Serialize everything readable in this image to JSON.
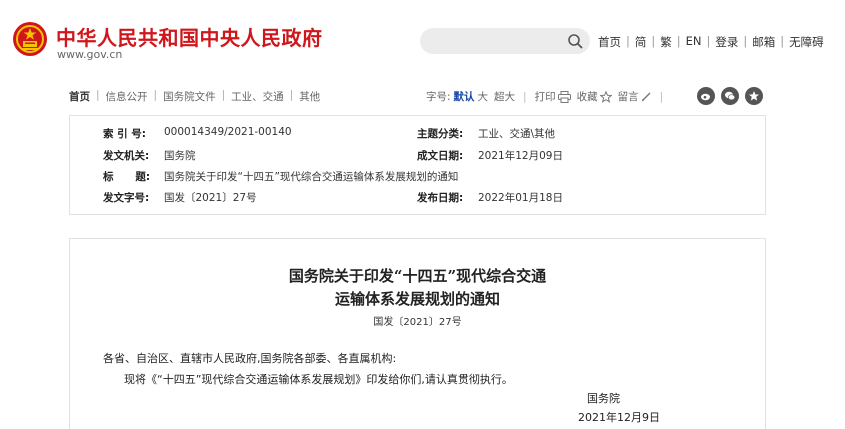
{
  "header": {
    "site_title": "中华人民共和国中央人民政府",
    "site_url": "www.gov.cn",
    "search_placeholder": "",
    "nav": [
      "首页",
      "简",
      "繁",
      "EN",
      "登录",
      "邮箱",
      "无障碍"
    ]
  },
  "breadcrumb": [
    "首页",
    "信息公开",
    "国务院文件",
    "工业、交通",
    "其他"
  ],
  "tools": {
    "font_label": "字号:",
    "font_default": "默认",
    "font_large": "大",
    "font_xlarge": "超大",
    "print": "打印",
    "favorite": "收藏",
    "comment": "留言"
  },
  "info": {
    "index_label": "索 引 号:",
    "index_value": "000014349/2021-00140",
    "topic_label": "主题分类:",
    "topic_value": "工业、交通\\其他",
    "issuer_label": "发文机关:",
    "issuer_value": "国务院",
    "written_label": "成文日期:",
    "written_value": "2021年12月09日",
    "title_label": "标      题:",
    "title_value": "国务院关于印发“十四五”现代综合交通运输体系发展规划的通知",
    "docno_label": "发文字号:",
    "docno_value": "国发〔2021〕27号",
    "published_label": "发布日期:",
    "published_value": "2022年01月18日"
  },
  "document": {
    "title_line1": "国务院关于印发“十四五”现代综合交通",
    "title_line2": "运输体系发展规划的通知",
    "doc_number": "国发〔2021〕27号",
    "salutation": "各省、自治区、直辖市人民政府,国务院各部委、各直属机构:",
    "body": "现将《“十四五”现代综合交通运输体系发展规划》印发给你们,请认真贯彻执行。",
    "signature": "国务院",
    "date": "2021年12月9日"
  },
  "colors": {
    "brand_red": "#d0161b",
    "font_active": "#1a4aa8"
  }
}
